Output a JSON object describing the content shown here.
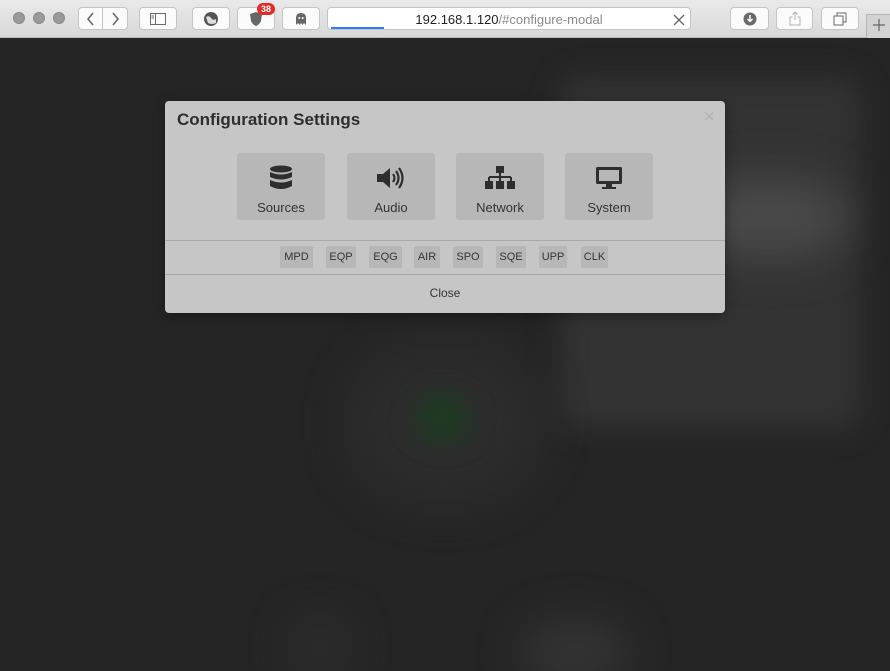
{
  "browser": {
    "url_host": "192.168.1.120",
    "url_path": "/#configure-modal",
    "extension_badge_count": "38",
    "icons": {
      "back": "chevron-left-icon",
      "forward": "chevron-right-icon",
      "sidebar": "sidebar-icon",
      "extension_1": "globe-icon",
      "extension_2": "ublock-icon",
      "extension_3": "ghost-icon",
      "clear_url": "close-icon",
      "downloads": "download-icon",
      "share": "share-icon",
      "tabs": "tabs-overview-icon",
      "new_tab": "plus-icon"
    }
  },
  "modal": {
    "title": "Configuration Settings",
    "close_x": "×",
    "tiles": [
      {
        "label": "Sources",
        "icon": "database-icon"
      },
      {
        "label": "Audio",
        "icon": "speaker-icon"
      },
      {
        "label": "Network",
        "icon": "network-icon"
      },
      {
        "label": "System",
        "icon": "monitor-icon"
      }
    ],
    "chips": [
      "MPD",
      "EQP",
      "EQG",
      "AIR",
      "SPO",
      "SQE",
      "UPP",
      "CLK"
    ],
    "close_label": "Close"
  }
}
